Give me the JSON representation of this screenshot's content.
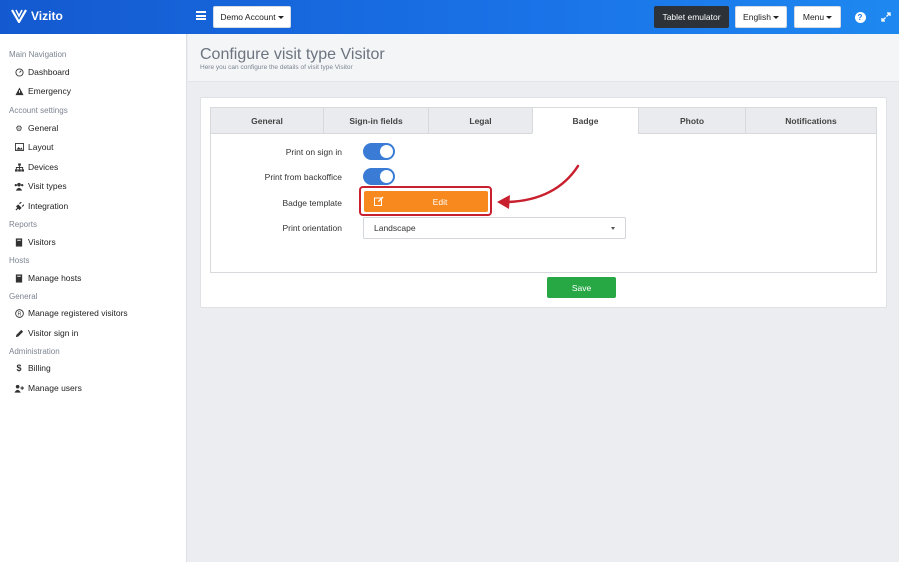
{
  "app": {
    "brand": "Vizito"
  },
  "topbar": {
    "account_label": "Demo Account",
    "tablet_label": "Tablet emulator",
    "language_label": "English",
    "menu_label": "Menu",
    "help_symbol": "?",
    "icons": [
      "logo-icon",
      "hamburger-icon",
      "help-icon",
      "expand-icon"
    ]
  },
  "sidebar": {
    "sections": [
      {
        "title": "Main Navigation",
        "items": [
          {
            "label": "Dashboard",
            "icon": "dashboard-icon"
          },
          {
            "label": "Emergency",
            "icon": "warning-icon"
          }
        ]
      },
      {
        "title": "Account settings",
        "items": [
          {
            "label": "General",
            "icon": "gear-icon"
          },
          {
            "label": "Layout",
            "icon": "image-icon"
          },
          {
            "label": "Devices",
            "icon": "sitemap-icon"
          },
          {
            "label": "Visit types",
            "icon": "users-icon"
          },
          {
            "label": "Integration",
            "icon": "plug-icon"
          }
        ]
      },
      {
        "title": "Reports",
        "items": [
          {
            "label": "Visitors",
            "icon": "book-icon"
          }
        ]
      },
      {
        "title": "Hosts",
        "items": [
          {
            "label": "Manage hosts",
            "icon": "book-icon"
          }
        ]
      },
      {
        "title": "General",
        "items": [
          {
            "label": "Manage registered visitors",
            "icon": "registered-icon"
          },
          {
            "label": "Visitor sign in",
            "icon": "pencil-icon"
          }
        ]
      },
      {
        "title": "Administration",
        "items": [
          {
            "label": "Billing",
            "icon": "dollar-icon"
          },
          {
            "label": "Manage users",
            "icon": "user-plus-icon"
          }
        ]
      }
    ]
  },
  "page": {
    "title": "Configure visit type Visitor",
    "subtitle": "Here you can configure the details of visit type Visitor"
  },
  "tabs": [
    {
      "label": "General",
      "active": false
    },
    {
      "label": "Sign-in fields",
      "active": false
    },
    {
      "label": "Legal",
      "active": false
    },
    {
      "label": "Badge",
      "active": true
    },
    {
      "label": "Photo",
      "active": false
    },
    {
      "label": "Notifications",
      "active": false
    }
  ],
  "form": {
    "print_on_sign_in": {
      "label": "Print on sign in",
      "enabled": true
    },
    "print_from_backoffice": {
      "label": "Print from backoffice",
      "enabled": true
    },
    "badge_template": {
      "label": "Badge template",
      "button_label": "Edit"
    },
    "print_orientation": {
      "label": "Print orientation",
      "value": "Landscape"
    },
    "save_label": "Save"
  },
  "colors": {
    "topbar": "#1a73e8",
    "toggle_on": "#3a7bd5",
    "edit_button": "#f7891f",
    "highlight": "#c8202e",
    "save_button": "#28a745"
  }
}
